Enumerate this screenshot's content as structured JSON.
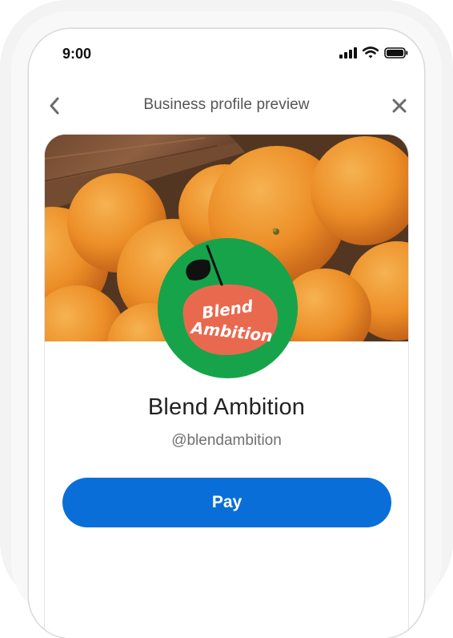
{
  "status_bar": {
    "time": "9:00",
    "icons": [
      "signal-icon",
      "wifi-icon",
      "battery-icon"
    ]
  },
  "nav": {
    "title": "Business profile preview",
    "back_icon": "chevron-left-icon",
    "close_icon": "close-icon"
  },
  "profile": {
    "name": "Blend Ambition",
    "handle": "@blendambition",
    "logo_text": "Blend Ambition",
    "cover": "oranges-cover-photo"
  },
  "actions": {
    "pay_label": "Pay"
  },
  "colors": {
    "primary": "#0a6ed9",
    "logo_green": "#17a34a",
    "logo_orange": "#e9694f"
  }
}
